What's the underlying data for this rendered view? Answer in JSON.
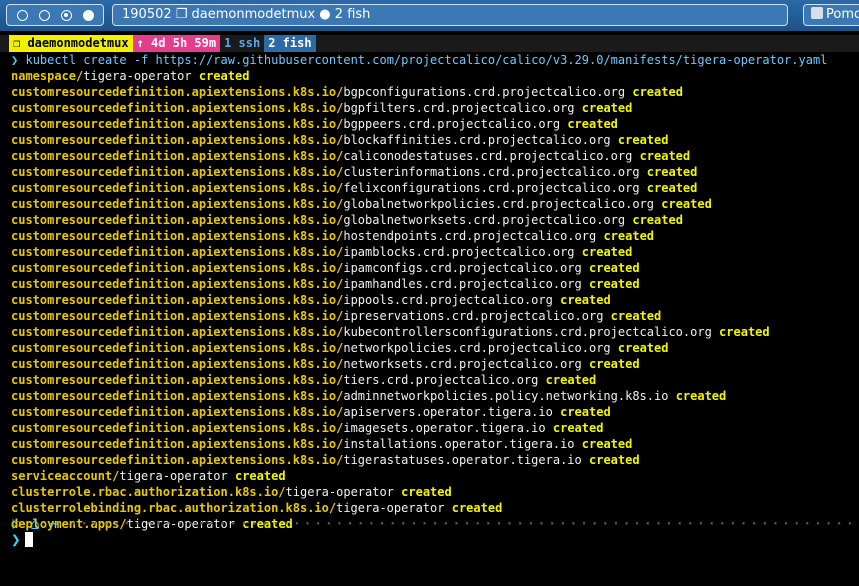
{
  "window": {
    "title": "190502 ❐ daemonmodetmux ● 2 fish",
    "pomo_label": "Pomo"
  },
  "tmux": {
    "session": "❐ daemonmodetmux",
    "uptime": "↑ 4d 5h 59m",
    "windows": [
      "1 ssh",
      "2 fish"
    ]
  },
  "command": {
    "prompt": "❯",
    "text": "kubectl create -f https://raw.githubusercontent.com/projectcalico/calico/v3.29.0/manifests/tigera-operator.yaml"
  },
  "output": [
    {
      "kind": "namespace/",
      "name": "tigera-operator",
      "status": "created"
    },
    {
      "kind": "customresourcedefinition.apiextensions.k8s.io/",
      "name": "bgpconfigurations.crd.projectcalico.org",
      "status": "created"
    },
    {
      "kind": "customresourcedefinition.apiextensions.k8s.io/",
      "name": "bgpfilters.crd.projectcalico.org",
      "status": "created"
    },
    {
      "kind": "customresourcedefinition.apiextensions.k8s.io/",
      "name": "bgppeers.crd.projectcalico.org",
      "status": "created"
    },
    {
      "kind": "customresourcedefinition.apiextensions.k8s.io/",
      "name": "blockaffinities.crd.projectcalico.org",
      "status": "created"
    },
    {
      "kind": "customresourcedefinition.apiextensions.k8s.io/",
      "name": "caliconodestatuses.crd.projectcalico.org",
      "status": "created"
    },
    {
      "kind": "customresourcedefinition.apiextensions.k8s.io/",
      "name": "clusterinformations.crd.projectcalico.org",
      "status": "created"
    },
    {
      "kind": "customresourcedefinition.apiextensions.k8s.io/",
      "name": "felixconfigurations.crd.projectcalico.org",
      "status": "created"
    },
    {
      "kind": "customresourcedefinition.apiextensions.k8s.io/",
      "name": "globalnetworkpolicies.crd.projectcalico.org",
      "status": "created"
    },
    {
      "kind": "customresourcedefinition.apiextensions.k8s.io/",
      "name": "globalnetworksets.crd.projectcalico.org",
      "status": "created"
    },
    {
      "kind": "customresourcedefinition.apiextensions.k8s.io/",
      "name": "hostendpoints.crd.projectcalico.org",
      "status": "created"
    },
    {
      "kind": "customresourcedefinition.apiextensions.k8s.io/",
      "name": "ipamblocks.crd.projectcalico.org",
      "status": "created"
    },
    {
      "kind": "customresourcedefinition.apiextensions.k8s.io/",
      "name": "ipamconfigs.crd.projectcalico.org",
      "status": "created"
    },
    {
      "kind": "customresourcedefinition.apiextensions.k8s.io/",
      "name": "ipamhandles.crd.projectcalico.org",
      "status": "created"
    },
    {
      "kind": "customresourcedefinition.apiextensions.k8s.io/",
      "name": "ippools.crd.projectcalico.org",
      "status": "created"
    },
    {
      "kind": "customresourcedefinition.apiextensions.k8s.io/",
      "name": "ipreservations.crd.projectcalico.org",
      "status": "created"
    },
    {
      "kind": "customresourcedefinition.apiextensions.k8s.io/",
      "name": "kubecontrollersconfigurations.crd.projectcalico.org",
      "status": "created"
    },
    {
      "kind": "customresourcedefinition.apiextensions.k8s.io/",
      "name": "networkpolicies.crd.projectcalico.org",
      "status": "created"
    },
    {
      "kind": "customresourcedefinition.apiextensions.k8s.io/",
      "name": "networksets.crd.projectcalico.org",
      "status": "created"
    },
    {
      "kind": "customresourcedefinition.apiextensions.k8s.io/",
      "name": "tiers.crd.projectcalico.org",
      "status": "created"
    },
    {
      "kind": "customresourcedefinition.apiextensions.k8s.io/",
      "name": "adminnetworkpolicies.policy.networking.k8s.io",
      "status": "created"
    },
    {
      "kind": "customresourcedefinition.apiextensions.k8s.io/",
      "name": "apiservers.operator.tigera.io",
      "status": "created"
    },
    {
      "kind": "customresourcedefinition.apiextensions.k8s.io/",
      "name": "imagesets.operator.tigera.io",
      "status": "created"
    },
    {
      "kind": "customresourcedefinition.apiextensions.k8s.io/",
      "name": "installations.operator.tigera.io",
      "status": "created"
    },
    {
      "kind": "customresourcedefinition.apiextensions.k8s.io/",
      "name": "tigerastatuses.operator.tigera.io",
      "status": "created"
    },
    {
      "kind": "serviceaccount/",
      "name": "tigera-operator",
      "status": "created"
    },
    {
      "kind": "clusterrole.rbac.authorization.k8s.io/",
      "name": "tigera-operator",
      "status": "created"
    },
    {
      "kind": "clusterrolebinding.rbac.authorization.k8s.io/",
      "name": "tigera-operator",
      "status": "created"
    },
    {
      "kind": "deployment.apps/",
      "name": "tigera-operator",
      "status": "created"
    }
  ],
  "prompt": {
    "path": "~",
    "arrow": "❯"
  },
  "colors": {
    "topbar": "#2a6aa6",
    "session_bg": "#f0f000",
    "uptime_bg": "#e63c8c",
    "active_window_bg": "#2a6aa6",
    "kind_text": "#e8c800",
    "status_text": "#f5f500",
    "command_text": "#6ec8ff"
  }
}
